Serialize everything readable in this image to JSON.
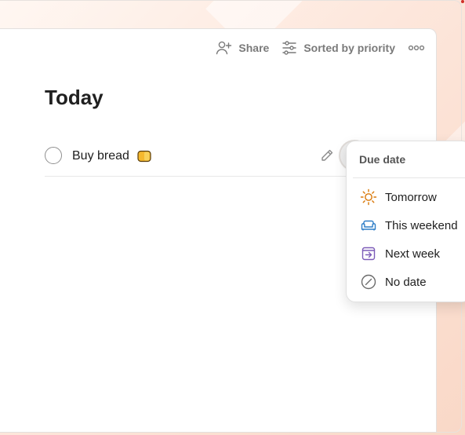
{
  "toolbar": {
    "share_label": "Share",
    "sort_label": "Sorted by priority",
    "share_icon": "add-person-icon",
    "sort_icon": "sliders-icon",
    "more_icon": "more-dots-icon"
  },
  "page": {
    "title": "Today"
  },
  "task": {
    "label": "Buy bread",
    "emoji_icon": "bread-icon",
    "actions": [
      "edit-icon",
      "calendar-icon",
      "comment-icon"
    ]
  },
  "due_menu": {
    "header": "Due date",
    "items": [
      {
        "label": "Tomorrow",
        "icon": "sun-icon",
        "color": "#d97706"
      },
      {
        "label": "This weekend",
        "icon": "couch-icon",
        "color": "#2f7ec7"
      },
      {
        "label": "Next week",
        "icon": "next-week-icon",
        "color": "#7c5bb8"
      },
      {
        "label": "No date",
        "icon": "no-date-icon",
        "color": "#6b6b6b"
      }
    ]
  },
  "colors": {
    "accent_bread": "#f5b82e",
    "muted_text": "#7a7a7a",
    "primary_text": "#202020"
  }
}
